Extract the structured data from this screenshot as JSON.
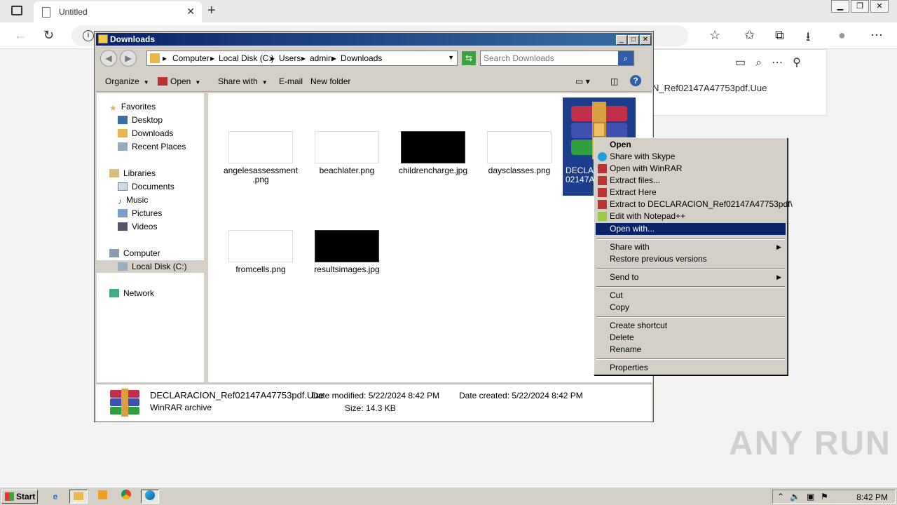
{
  "browser": {
    "tab_title": "Untitled",
    "tab_close": "✕",
    "new_tab": "+",
    "download_item": "N_Ref02147A47753pdf.Uue",
    "watermark": "ANY RUN"
  },
  "explorer": {
    "title": "Downloads",
    "path": [
      "Computer",
      "Local Disk (C:)",
      "Users",
      "admin",
      "Downloads"
    ],
    "search_placeholder": "Search Downloads",
    "toolbar": {
      "organize": "Organize",
      "open": "Open",
      "share_with": "Share with",
      "email": "E-mail",
      "new_folder": "New folder"
    },
    "nav": {
      "favorites": "Favorites",
      "desktop": "Desktop",
      "downloads": "Downloads",
      "recent_places": "Recent Places",
      "libraries": "Libraries",
      "documents": "Documents",
      "music": "Music",
      "pictures": "Pictures",
      "videos": "Videos",
      "computer": "Computer",
      "local_disk": "Local Disk (C:)",
      "network": "Network"
    },
    "files": [
      {
        "name_line1": "angelesassessment",
        "name_line2": ".png",
        "dark": false
      },
      {
        "name_line1": "beachlater.png",
        "name_line2": "",
        "dark": false
      },
      {
        "name_line1": "childrencharge.jpg",
        "name_line2": "",
        "dark": true
      },
      {
        "name_line1": "daysclasses.png",
        "name_line2": "",
        "dark": false
      },
      {
        "name_line1": "fromcells.png",
        "name_line2": "",
        "dark": false
      },
      {
        "name_line1": "resultsimages.jpg",
        "name_line2": "",
        "dark": true
      }
    ],
    "selected_file": {
      "label_line1": "DECLAR",
      "label_line2": "02147A4"
    },
    "details": {
      "filename": "DECLARACION_Ref02147A47753pdf.Uue",
      "type": "WinRAR archive",
      "date_modified": "Date modified: 5/22/2024 8:42 PM",
      "size": "Size: 14.3 KB",
      "date_created": "Date created: 5/22/2024 8:42 PM"
    }
  },
  "context_menu": {
    "open": "Open",
    "share_skype": "Share with Skype",
    "open_winrar": "Open with WinRAR",
    "extract_files": "Extract files...",
    "extract_here": "Extract Here",
    "extract_to": "Extract to DECLARACION_Ref02147A47753pdf\\",
    "edit_notepad": "Edit with Notepad++",
    "open_with": "Open with...",
    "share_with": "Share with",
    "restore": "Restore previous versions",
    "send_to": "Send to",
    "cut": "Cut",
    "copy": "Copy",
    "create_shortcut": "Create shortcut",
    "delete": "Delete",
    "rename": "Rename",
    "properties": "Properties"
  },
  "taskbar": {
    "start": "Start",
    "clock": "8:42 PM"
  },
  "colors": {
    "selection": "#0a246a",
    "title_bar": "#0a246a",
    "file_selected_bg": "#1c3c8c"
  }
}
